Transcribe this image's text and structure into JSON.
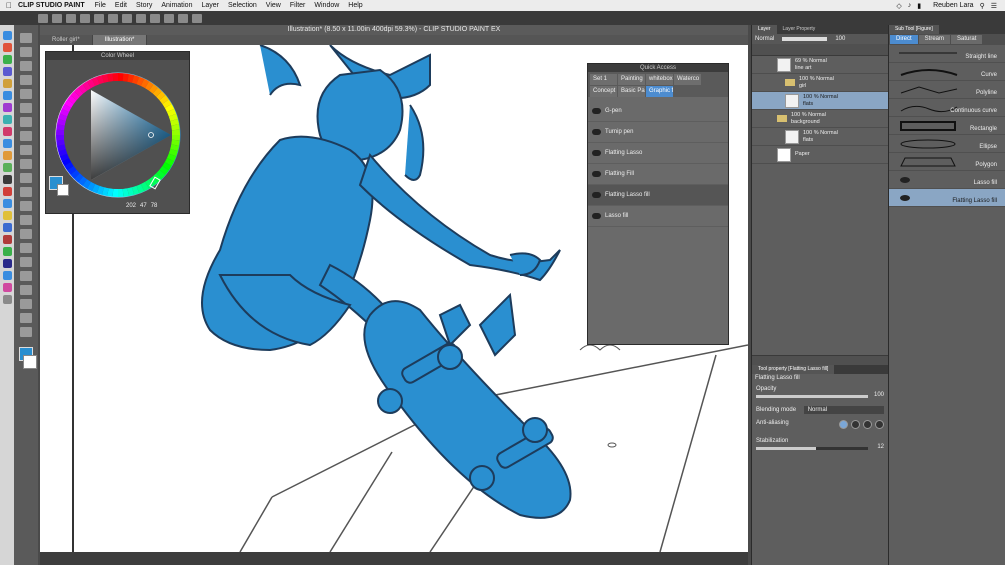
{
  "menubar": {
    "app_name": "CLIP STUDIO PAINT",
    "items": [
      "File",
      "Edit",
      "Story",
      "Animation",
      "Layer",
      "Selection",
      "View",
      "Filter",
      "Window",
      "Help"
    ],
    "user": "Reuben Lara"
  },
  "window": {
    "title": "Illustration* (8.50 x 11.00in 400dpi 59.3%) - CLIP STUDIO PAINT EX"
  },
  "doc_tabs": [
    "Roller girl*",
    "Illustration*"
  ],
  "color_wheel": {
    "title": "Color Wheel",
    "main_color": "#2a8fd0",
    "sub_color": "#ffffff",
    "readout": {
      "h": "202",
      "s": "47",
      "v": "78"
    }
  },
  "quick_access": {
    "title": "Quick Access",
    "tabs": [
      "Set 1",
      "Painting",
      "whitebox",
      "Waterco",
      "Concept",
      "Basic Pai",
      "Graphic fi"
    ],
    "active_tab": "Graphic fi",
    "items": [
      "G-pen",
      "Turnip pen",
      "Flatting Lasso",
      "Flatting Fill",
      "Flatting Lasso fill",
      "Lasso fill"
    ],
    "active_item": "Flatting Lasso fill"
  },
  "layer_panel": {
    "tabs": [
      "Layer",
      "Layer Property"
    ],
    "blend_mode": "Normal",
    "opacity": "100",
    "layers": [
      {
        "pct": "69 % Normal",
        "name": "line art",
        "type": "raster"
      },
      {
        "pct": "100 % Normal",
        "name": "girl",
        "type": "folder"
      },
      {
        "pct": "100 % Normal",
        "name": "flats",
        "type": "raster",
        "selected": true
      },
      {
        "pct": "100 % Normal",
        "name": "background",
        "type": "folder"
      },
      {
        "pct": "100 % Normal",
        "name": "flats",
        "type": "raster"
      },
      {
        "pct": "",
        "name": "Paper",
        "type": "paper"
      }
    ]
  },
  "tool_property": {
    "tab": "Tool property [Flatting Lasso fill]",
    "tool_name": "Flatting Lasso fill",
    "opacity_label": "Opacity",
    "opacity_value": "100",
    "blending_label": "Blending mode",
    "blending_value": "Normal",
    "antialias_label": "Anti-aliasing",
    "stabilization_label": "Stabilization",
    "stabilization_value": "12"
  },
  "sub_tool": {
    "tab": "Sub Tool [Figure]",
    "tabs": [
      "Direct",
      "Stream",
      "Saturat"
    ],
    "items": [
      "Straight line",
      "Curve",
      "Polyline",
      "Continuous curve",
      "Rectangle",
      "Ellipse",
      "Polygon",
      "Lasso fill",
      "Flatting Lasso fill"
    ],
    "active_item": "Flatting Lasso fill"
  },
  "colors": {
    "accent": "#4c8cd0",
    "fill_blue": "#2a8fd0",
    "selected_row": "#8aa6c4"
  }
}
